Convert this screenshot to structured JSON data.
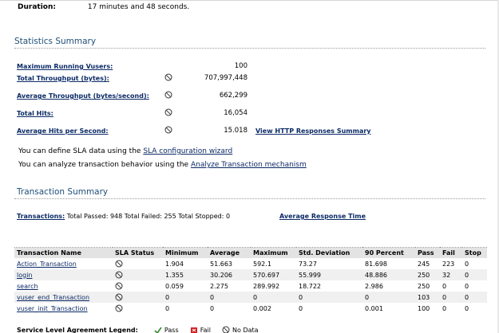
{
  "duration": {
    "label": "Duration:",
    "value": "17 minutes and 48 seconds."
  },
  "statistics": {
    "title": "Statistics Summary",
    "rows": [
      {
        "label": "Maximum Running Vusers:",
        "value": "100",
        "has_icon": false
      },
      {
        "label": "Total Throughput (bytes):",
        "value": "707,997,448",
        "has_icon": true
      },
      {
        "label": "Average Throughput (bytes/second):",
        "value": "662,299",
        "has_icon": true
      },
      {
        "label": "Total Hits:",
        "value": "16,054",
        "has_icon": true
      },
      {
        "label": "Average Hits per Second:",
        "value": "15.018",
        "has_icon": true
      }
    ],
    "http_link": "View HTTP Responses Summary"
  },
  "sla": {
    "line1_prefix": "You can define SLA data using the ",
    "line1_link": "SLA configuration wizard",
    "line2_prefix": "You can analyze transaction behavior using the ",
    "line2_link": "Analyze Transaction mechanism"
  },
  "transactions": {
    "title": "Transaction Summary",
    "summary_label": "Transactions:",
    "summary_text": " Total Passed: 948 Total Failed: 255 Total Stopped: 0",
    "art_link": "Average Response Time",
    "columns": [
      "Transaction Name",
      "SLA Status",
      "Minimum",
      "Average",
      "Maximum",
      "Std. Deviation",
      "90 Percent",
      "Pass",
      "Fail",
      "Stop"
    ],
    "rows": [
      [
        "Action_Transaction",
        "",
        "1.904",
        "51.663",
        "592.1",
        "73.27",
        "81.698",
        "245",
        "223",
        "0"
      ],
      [
        "login",
        "",
        "1.355",
        "30.206",
        "570.697",
        "55.999",
        "48.886",
        "250",
        "32",
        "0"
      ],
      [
        "search",
        "",
        "0.059",
        "2.275",
        "289.992",
        "18.722",
        "2.986",
        "250",
        "0",
        "0"
      ],
      [
        "vuser_end_Transaction",
        "",
        "0",
        "0",
        "0",
        "0",
        "0",
        "103",
        "0",
        "0"
      ],
      [
        "vuser_init_Transaction",
        "",
        "0",
        "0",
        "0.002",
        "0",
        "0.001",
        "100",
        "0",
        "0"
      ]
    ]
  },
  "legend": {
    "label": "Service Level Agreement Legend:",
    "pass": "Pass",
    "fail": "Fail",
    "no_data": "No Data"
  },
  "colors": {
    "link": "#0b2a66",
    "section_title": "#1f4e79",
    "header_bg": "#e3e3e3",
    "pass_green": "#2e8b2e",
    "fail_red": "#d22222"
  },
  "icons": {
    "sla_no_data": "no-data-icon",
    "pass": "check-icon",
    "fail": "fail-box-icon"
  }
}
